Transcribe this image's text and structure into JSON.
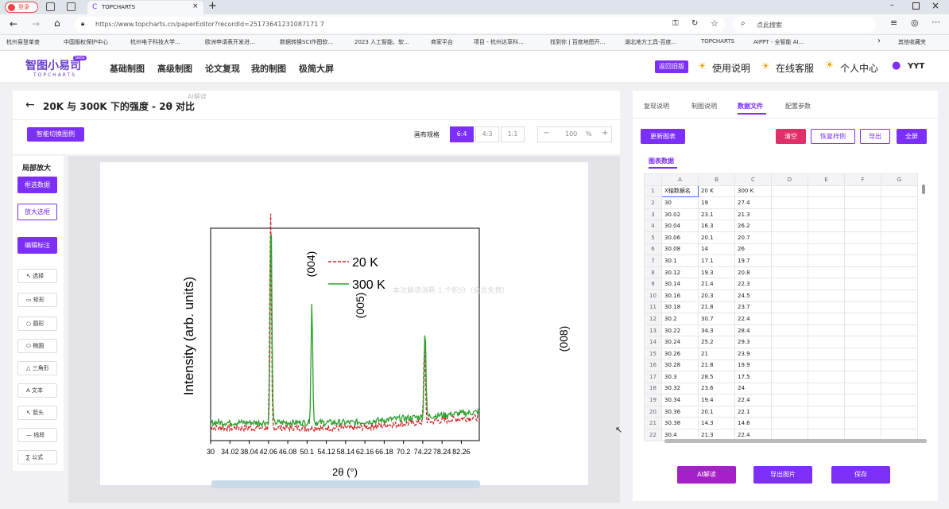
{
  "browser": {
    "profile_label": "登录",
    "tab_title": "TOPCHARTS",
    "url": "https://www.topcharts.cn/paperEditor?recordId=25173641231087171 7",
    "search_placeholder": "点此搜索",
    "bookmarks": [
      "杭州易登单查",
      "中国版权保护中心",
      "杭州电子科技大学...",
      "欧洲申请表开发进...",
      "数据转换SCI作图软...",
      "2023 人工智能、软...",
      "商家平台",
      "项目 - 杭州达草科...",
      "找到你 | 百度地图开...",
      "湖北地方工具-百度...",
      "TOPCHARTS",
      "AIPPT - 全智能 AI..."
    ],
    "other_bookmarks": "其他收藏夹"
  },
  "app": {
    "logo_cn": "智图小易司",
    "logo_en": "TOPCHARTS",
    "logo_badge": "beta",
    "nav": [
      "基础制图",
      "高级制图",
      "论文复现",
      "我的制图",
      "极简大屏"
    ],
    "old_version": "返回旧版",
    "help": "使用说明",
    "service": "在线客服",
    "personal": "个人中心",
    "user": "YYT"
  },
  "editor": {
    "back_arrow": "←",
    "title": "20K 与 300K 下的强度 - 2θ 对比",
    "smart_switch": "智能切换图例",
    "canvas_label": "画布规格",
    "ratios": [
      "6:4",
      "4:3",
      "1:1"
    ],
    "zoom_minus": "−",
    "zoom_value": "100",
    "zoom_unit": "%",
    "zoom_plus": "+"
  },
  "left_tools": {
    "section_title": "局部放大",
    "select_data": "框选数据",
    "zoom_selection": "放大选框",
    "edit_annotation": "编辑标注",
    "tools": [
      "选择",
      "矩形",
      "圆形",
      "椭圆",
      "三角形",
      "文本",
      "箭头",
      "线段",
      "公式"
    ]
  },
  "chart_data": {
    "type": "line",
    "xlabel": "2θ (°)",
    "ylabel": "Intensity (arb. units)",
    "x_ticks": [
      "30",
      "34.02",
      "38.04",
      "42.06",
      "46.08",
      "50.1",
      "54.12",
      "58.14",
      "62.16",
      "66.18",
      "70.2",
      "74.22",
      "78.24",
      "82.26"
    ],
    "xlim": [
      30,
      86
    ],
    "legend": [
      "20 K",
      "300 K"
    ],
    "peak_labels": [
      "(004)",
      "(005)",
      "(008)"
    ],
    "series": [
      {
        "name": "20 K",
        "color": "#cc2222",
        "style": "dashed",
        "peaks": [
          {
            "x": 42.5,
            "y": 1.0
          },
          {
            "x": 74.6,
            "y": 0.36
          }
        ],
        "baseline": 0.045
      },
      {
        "name": "300 K",
        "color": "#2ca02c",
        "style": "solid",
        "peaks": [
          {
            "x": 42.6,
            "y": 0.97
          },
          {
            "x": 51.1,
            "y": 0.56
          },
          {
            "x": 74.7,
            "y": 0.42
          }
        ],
        "baseline": 0.07
      }
    ]
  },
  "right_panel": {
    "tabs": [
      "复现说明",
      "制图说明",
      "数据文件",
      "配置参数"
    ],
    "active_tab": "数据文件",
    "update_chart": "更新图表",
    "clear": "清空",
    "restore": "恢复样例",
    "import": "导出",
    "fullscreen": "全屏",
    "sheet_tab": "图表数据",
    "columns": [
      "A",
      "B",
      "C",
      "D",
      "E",
      "F",
      "G"
    ],
    "rows": [
      [
        "X轴数据名",
        "20 K",
        "300 K"
      ],
      [
        "30",
        "19",
        "27.4"
      ],
      [
        "30.02",
        "23.1",
        "21.3"
      ],
      [
        "30.04",
        "16.3",
        "26.2"
      ],
      [
        "30.06",
        "20.1",
        "20.7"
      ],
      [
        "30.08",
        "14",
        "26"
      ],
      [
        "30.1",
        "17.1",
        "19.7"
      ],
      [
        "30.12",
        "19.3",
        "20.8"
      ],
      [
        "30.14",
        "21.4",
        "22.3"
      ],
      [
        "30.16",
        "20.3",
        "24.5"
      ],
      [
        "30.18",
        "21.8",
        "23.7"
      ],
      [
        "30.2",
        "30.7",
        "22.4"
      ],
      [
        "30.22",
        "34.3",
        "28.4"
      ],
      [
        "30.24",
        "25.2",
        "29.3"
      ],
      [
        "30.26",
        "21",
        "23.9"
      ],
      [
        "30.28",
        "21.8",
        "19.9"
      ],
      [
        "30.3",
        "28.5",
        "17.5"
      ],
      [
        "30.32",
        "23.6",
        "24"
      ],
      [
        "30.34",
        "19.4",
        "22.4"
      ],
      [
        "30.36",
        "20.1",
        "22.1"
      ],
      [
        "30.38",
        "14.3",
        "14.6"
      ],
      [
        "30.4",
        "21.3",
        "22.4"
      ]
    ],
    "ai_button": "AI解读",
    "export_image": "导出图片",
    "save": "保存"
  },
  "overlay": {
    "faded_title": "AI解读",
    "faded_text": "本次解读消耗 1 个积分（会员免费）"
  },
  "colors": {
    "accent": "#7b2ff7",
    "danger": "#e0306a",
    "green": "#2ca02c",
    "red": "#cc2222"
  }
}
